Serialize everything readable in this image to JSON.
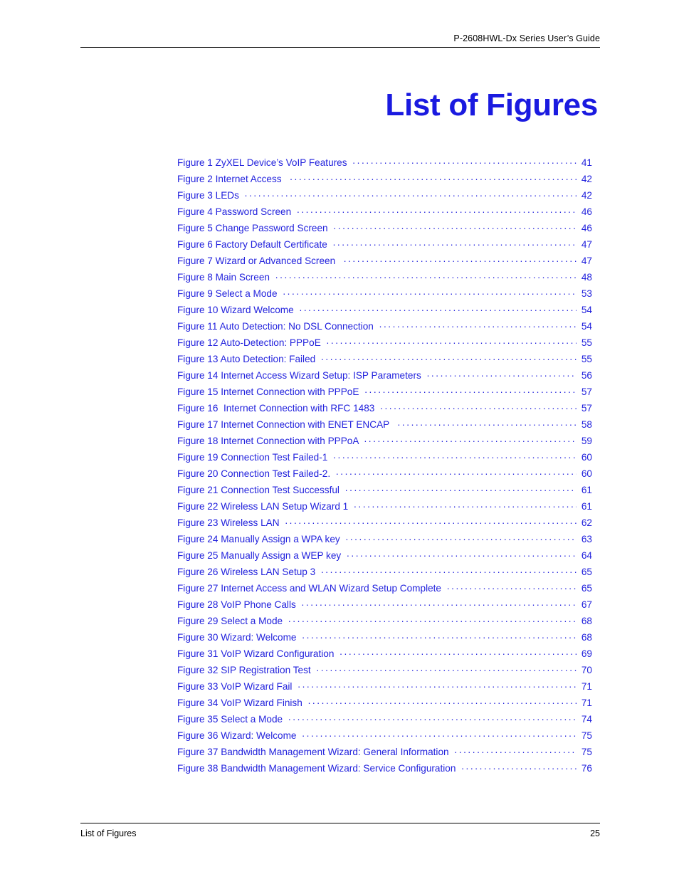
{
  "header": {
    "running_title": "P-2608HWL-Dx Series User’s Guide"
  },
  "title": "List of Figures",
  "colors": {
    "heading_blue": "#1a1ae0",
    "entry_blue": "#2222dd",
    "rule_black": "#000000",
    "page_background": "#ffffff"
  },
  "figures": [
    {
      "label": "Figure 1 ZyXEL Device’s VoIP Features ",
      "page": "41"
    },
    {
      "label": "Figure 2 Internet Access  ",
      "page": "42"
    },
    {
      "label": "Figure 3 LEDs ",
      "page": "42"
    },
    {
      "label": "Figure 4 Password Screen ",
      "page": "46"
    },
    {
      "label": "Figure 5 Change Password Screen ",
      "page": "46"
    },
    {
      "label": "Figure 6 Factory Default Certificate ",
      "page": "47"
    },
    {
      "label": "Figure 7 Wizard or Advanced Screen  ",
      "page": "47"
    },
    {
      "label": "Figure 8 Main Screen ",
      "page": "48"
    },
    {
      "label": "Figure 9 Select a Mode ",
      "page": "53"
    },
    {
      "label": "Figure 10 Wizard Welcome ",
      "page": "54"
    },
    {
      "label": "Figure 11 Auto Detection: No DSL Connection ",
      "page": "54"
    },
    {
      "label": "Figure 12 Auto-Detection: PPPoE ",
      "page": "55"
    },
    {
      "label": "Figure 13 Auto Detection: Failed ",
      "page": "55"
    },
    {
      "label": "Figure 14 Internet Access Wizard Setup: ISP Parameters ",
      "page": "56"
    },
    {
      "label": "Figure 15 Internet Connection with PPPoE ",
      "page": "57"
    },
    {
      "label": "Figure 16  Internet Connection with RFC 1483 ",
      "page": "57"
    },
    {
      "label": "Figure 17 Internet Connection with ENET ENCAP  ",
      "page": "58"
    },
    {
      "label": "Figure 18 Internet Connection with PPPoA ",
      "page": "59"
    },
    {
      "label": "Figure 19 Connection Test Failed-1 ",
      "page": "60"
    },
    {
      "label": "Figure 20 Connection Test Failed-2. ",
      "page": "60"
    },
    {
      "label": "Figure 21 Connection Test Successful ",
      "page": "61"
    },
    {
      "label": "Figure 22 Wireless LAN Setup Wizard 1 ",
      "page": "61"
    },
    {
      "label": "Figure 23 Wireless LAN ",
      "page": "62"
    },
    {
      "label": "Figure 24 Manually Assign a WPA key ",
      "page": "63"
    },
    {
      "label": "Figure 25 Manually Assign a WEP key ",
      "page": "64"
    },
    {
      "label": "Figure 26 Wireless LAN Setup 3 ",
      "page": "65"
    },
    {
      "label": "Figure 27 Internet Access and WLAN Wizard Setup Complete ",
      "page": "65"
    },
    {
      "label": "Figure 28 VoIP Phone Calls ",
      "page": "67"
    },
    {
      "label": "Figure 29 Select a Mode ",
      "page": "68"
    },
    {
      "label": "Figure 30 Wizard: Welcome ",
      "page": "68"
    },
    {
      "label": "Figure 31 VoIP Wizard Configuration ",
      "page": "69"
    },
    {
      "label": "Figure 32 SIP Registration Test ",
      "page": "70"
    },
    {
      "label": "Figure 33 VoIP Wizard Fail ",
      "page": "71"
    },
    {
      "label": "Figure 34 VoIP Wizard Finish ",
      "page": "71"
    },
    {
      "label": "Figure 35 Select a Mode ",
      "page": "74"
    },
    {
      "label": "Figure 36 Wizard: Welcome ",
      "page": "75"
    },
    {
      "label": "Figure 37 Bandwidth Management Wizard: General Information ",
      "page": "75"
    },
    {
      "label": "Figure 38 Bandwidth Management Wizard: Service Configuration ",
      "page": "76"
    }
  ],
  "footer": {
    "section_name": "List of Figures",
    "page_number": "25"
  }
}
